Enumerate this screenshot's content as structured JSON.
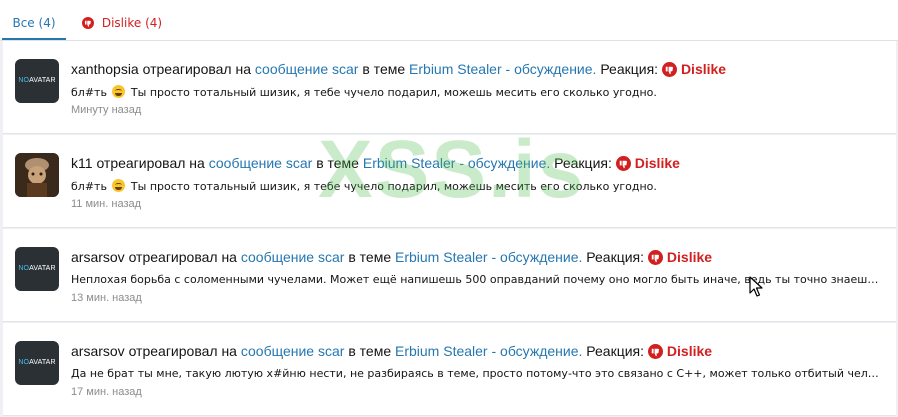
{
  "tabs": [
    {
      "label": "Все",
      "count": "(4)"
    },
    {
      "label": "Dislike",
      "count": "(4)"
    }
  ],
  "phrases": {
    "reacted_on": "отреагировал на",
    "message_by": "сообщение scar",
    "in_topic": "в теме",
    "reaction": "Реакция:"
  },
  "avatar_placeholder": {
    "no": "NO",
    "avatar": "AVATAR"
  },
  "notifications": [
    {
      "user": "xanthopsia",
      "thread": "Erbium Stealer - обсуждение.",
      "reaction_label": "Dislike",
      "snippet_before": "бл#ть",
      "snippet_after": "Ты просто тотальный шизик, я тебе чучело подарил, можешь месить его сколько угодно.",
      "time": "Минуту назад",
      "avatar": "no-avatar"
    },
    {
      "user": "k11",
      "thread": "Erbium Stealer - обсуждение.",
      "reaction_label": "Dislike",
      "snippet_before": "бл#ть",
      "snippet_after": "Ты просто тотальный шизик, я тебе чучело подарил, можешь месить его сколько угодно.",
      "time": "11 мин. назад",
      "avatar": "photo"
    },
    {
      "user": "arsarsov",
      "thread": "Erbium Stealer - обсуждение.",
      "reaction_label": "Dislike",
      "snippet": "Неплохая борьба с соломенными чучелами. Может ещё напишешь 500 оправданий почему оно могло быть иначе, ведь ты точно знаешь...",
      "time": "13 мин. назад",
      "avatar": "no-avatar"
    },
    {
      "user": "arsarsov",
      "thread": "Erbium Stealer - обсуждение.",
      "reaction_label": "Dislike",
      "snippet": "Да не брат ты мне, такую лютую х#йню нести, не разбираясь в теме, просто потому-что это связано с С++, может только отбитый чел, по...",
      "time": "17 мин. назад",
      "avatar": "no-avatar"
    }
  ],
  "watermark": "XSS.is",
  "colors": {
    "link": "#2577b1",
    "dislike": "#d21f1f",
    "muted": "#8c8c8c"
  }
}
